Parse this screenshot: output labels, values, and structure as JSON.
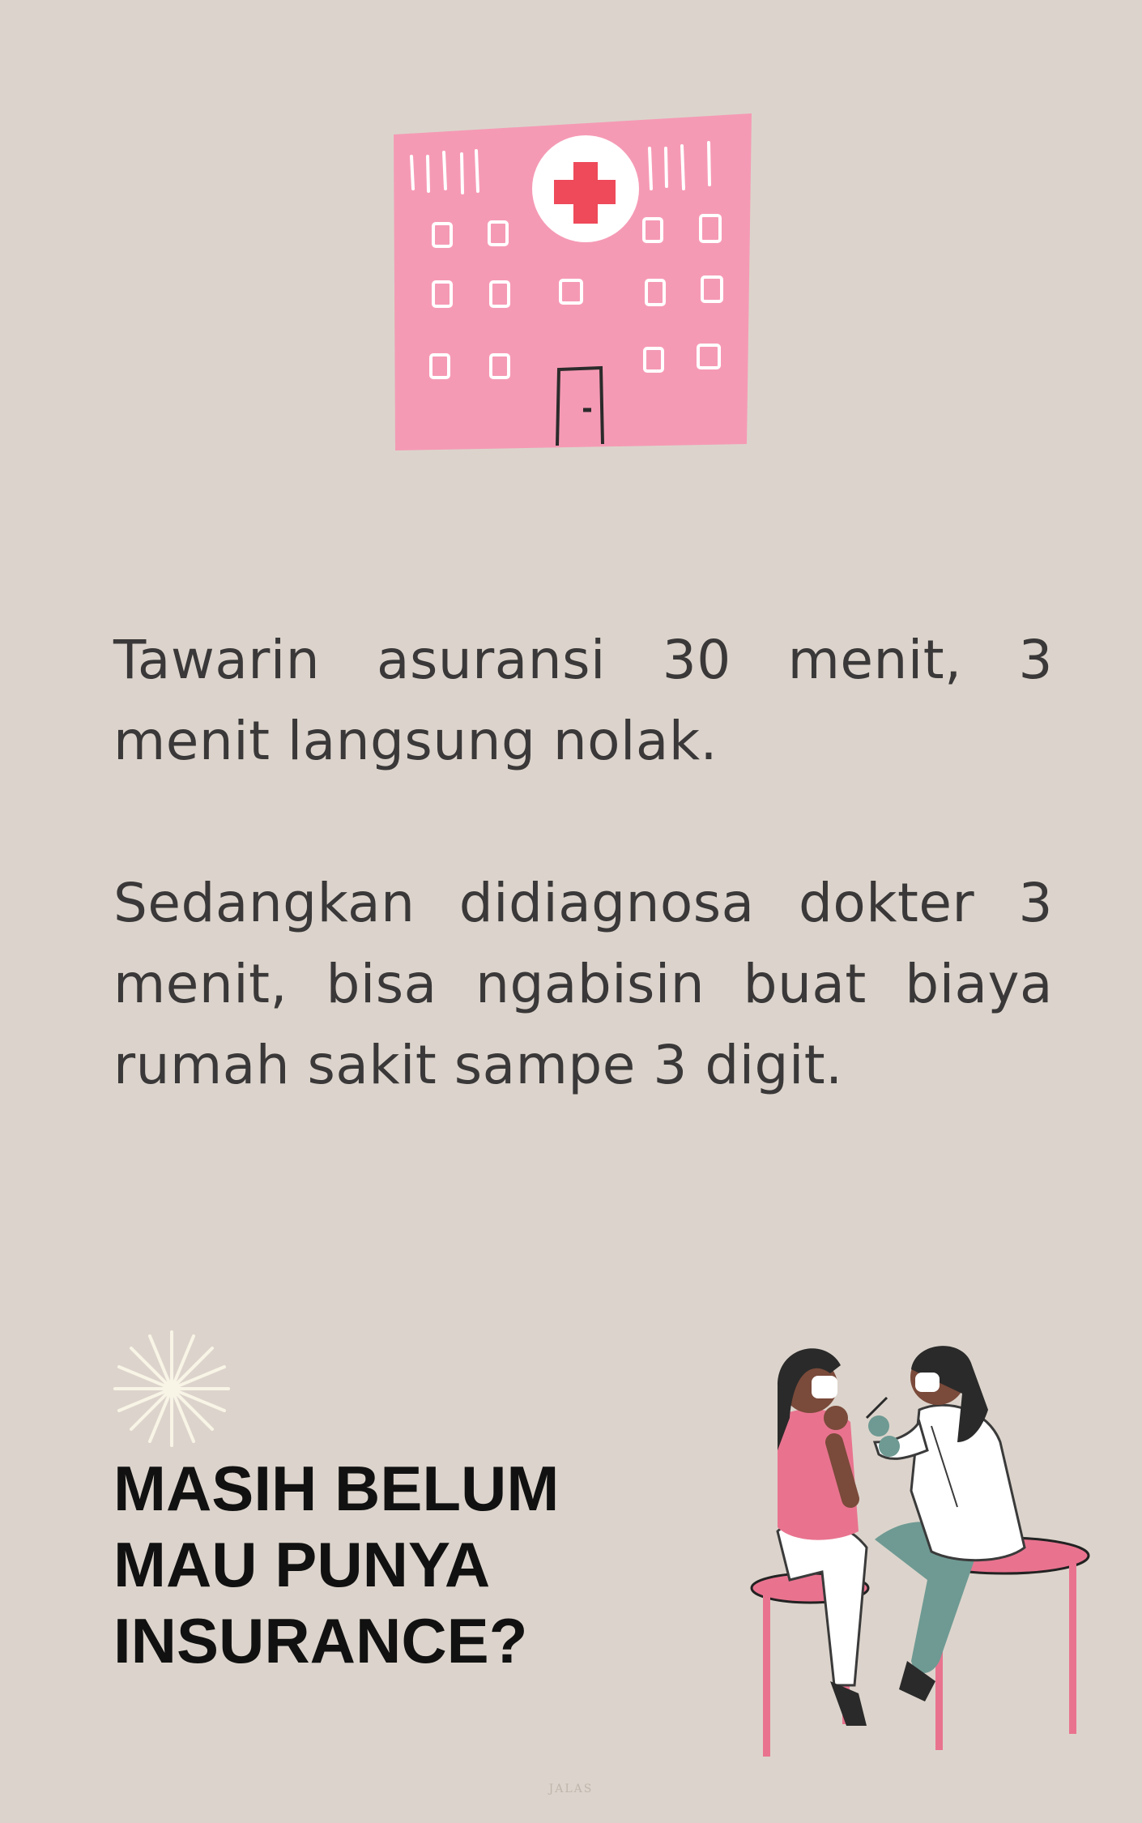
{
  "paragraphs": [
    "Tawarin asuransi 30 menit, 3 menit langsung nolak.",
    "Sedangkan didiagnosa dokter 3 menit, bisa ngabisin buat biaya rumah sakit sampe 3 digit."
  ],
  "cta": {
    "lines": [
      "MASIH BELUM",
      "MAU PUNYA",
      "INSURANCE?"
    ]
  },
  "footer": {
    "text": "JALAS"
  },
  "icons": {
    "hospital": "hospital-illustration",
    "sparkle": "sparkle-icon",
    "vaccination": "vaccination-illustration"
  },
  "colors": {
    "background": "#dcd4cc",
    "hospital_pink": "#f59ab5",
    "cross_red": "#ee4a5a",
    "text_dark": "#3a3838",
    "sparkle": "#f8f4e6"
  }
}
